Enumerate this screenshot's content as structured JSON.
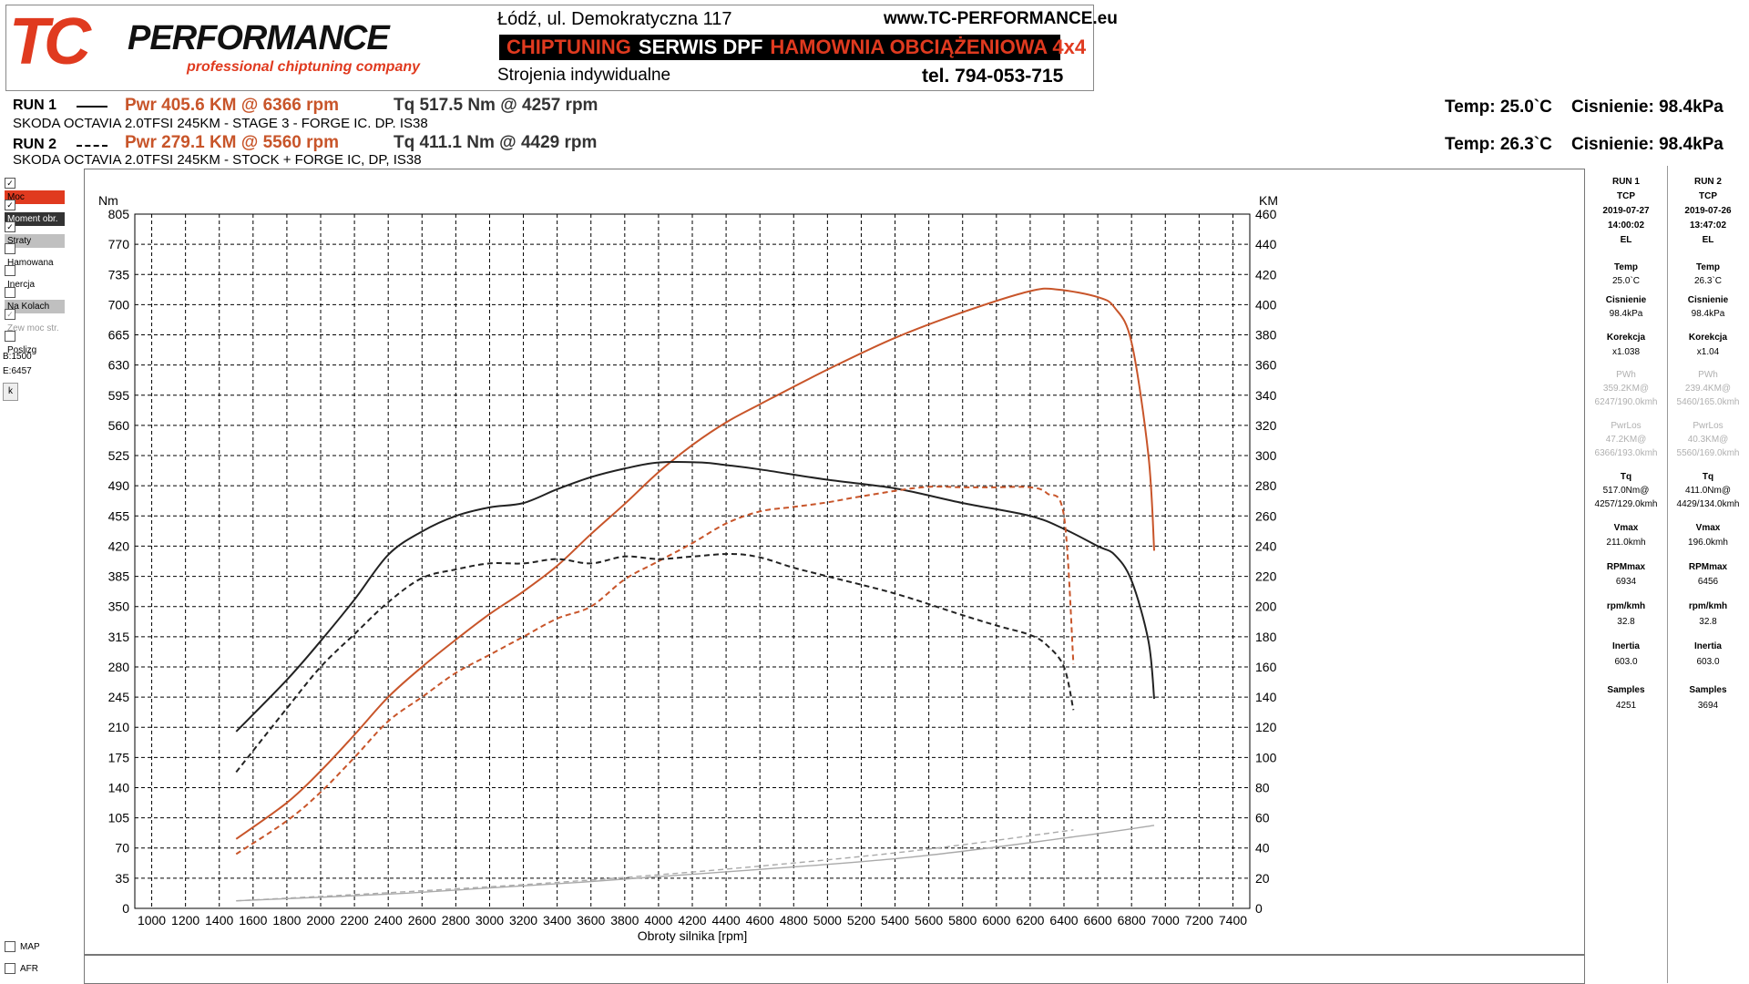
{
  "header": {
    "logo_tc": "TC",
    "logo_perf": "PERFORMANCE",
    "logo_sub": "professional chiptuning company",
    "address": "Łódź, ul. Demokratyczna 117",
    "website": "www.TC-PERFORMANCE.eu",
    "bar_chiptuning": "CHIPTUNING",
    "bar_dpf": "SERWIS DPF",
    "bar_hamownia": "HAMOWNIA OBCIĄŻENIOWA 4x4",
    "individual": "Strojenia indywidualne",
    "phone": "tel. 794-053-715",
    "brand_color": "#e03a1f"
  },
  "runs": [
    {
      "label": "RUN 1",
      "pwr": "Pwr  405.6 KM @ 6366 rpm",
      "tq": "Tq 517.5 Nm @ 4257 rpm",
      "desc": "SKODA OCTAVIA 2.0TFSI 245KM - STAGE 3 - FORGE IC. DP. IS38",
      "temp": "Temp: 25.0`C    Cisnienie: 98.4kPa"
    },
    {
      "label": "RUN 2",
      "pwr": "Pwr  279.1 KM @ 5560 rpm",
      "tq": "Tq 411.1 Nm @ 4429 rpm",
      "desc": "SKODA OCTAVIA 2.0TFSI 245KM - STOCK + FORGE IC, DP, IS38",
      "temp": "Temp: 26.3`C    Cisnienie: 98.4kPa"
    }
  ],
  "left_panel": {
    "checks": [
      {
        "label": "Moc",
        "checked": true,
        "bg": "#e03a1f"
      },
      {
        "label": "Moment obr.",
        "checked": true,
        "bg": "#333333"
      },
      {
        "label": "Straty",
        "checked": true,
        "bg": "#c0c0c0"
      },
      {
        "label": "Hamowana",
        "checked": false,
        "bg": ""
      },
      {
        "label": "Inercja",
        "checked": false,
        "bg": ""
      },
      {
        "label": "Na Kolach",
        "checked": false,
        "bg": "#c0c0c0"
      },
      {
        "label": "Zew moc str.",
        "checked": true,
        "bg": ""
      },
      {
        "label": "Poslizg",
        "checked": false,
        "bg": ""
      }
    ],
    "b_value": "B:1500",
    "e_value": "E:6457",
    "k_button": "k",
    "map": "MAP",
    "afr": "AFR"
  },
  "right_panel": [
    {
      "head": [
        "RUN 1",
        "TCP",
        "2019-07-27",
        "14:00:02",
        "EL"
      ],
      "temp_l": "Temp",
      "temp": "25.0`C",
      "cis_l": "Cisnienie",
      "cis": "98.4kPa",
      "kor_l": "Korekcja",
      "kor": "x1.038",
      "pwh_l": "PWh",
      "pwh": "359.2KM@",
      "pwh2": "6247/190.0kmh",
      "pwrlos_l": "PwrLos",
      "pwrlos": "47.2KM@",
      "pwrlos2": "6366/193.0kmh",
      "tq_l": "Tq",
      "tq": "517.0Nm@",
      "tq2": "4257/129.0kmh",
      "vmax_l": "Vmax",
      "vmax": "211.0kmh",
      "rpmmax_l": "RPMmax",
      "rpmmax": "6934",
      "rpmkmh_l": "rpm/kmh",
      "rpmkmh": "32.8",
      "inertia_l": "Inertia",
      "inertia": "603.0",
      "samples_l": "Samples",
      "samples": "4251"
    },
    {
      "head": [
        "RUN 2",
        "TCP",
        "2019-07-26",
        "13:47:02",
        "EL"
      ],
      "temp_l": "Temp",
      "temp": "26.3`C",
      "cis_l": "Cisnienie",
      "cis": "98.4kPa",
      "kor_l": "Korekcja",
      "kor": "x1.04",
      "pwh_l": "PWh",
      "pwh": "239.4KM@",
      "pwh2": "5460/165.0kmh",
      "pwrlos_l": "PwrLos",
      "pwrlos": "40.3KM@",
      "pwrlos2": "5560/169.0kmh",
      "tq_l": "Tq",
      "tq": "411.0Nm@",
      "tq2": "4429/134.0kmh",
      "vmax_l": "Vmax",
      "vmax": "196.0kmh",
      "rpmmax_l": "RPMmax",
      "rpmmax": "6456",
      "rpmkmh_l": "rpm/kmh",
      "rpmkmh": "32.8",
      "inertia_l": "Inertia",
      "inertia": "603.0",
      "samples_l": "Samples",
      "samples": "3694"
    }
  ],
  "chart_data": {
    "type": "line",
    "xlabel": "Obroty silnika [rpm]",
    "ylabel_left": "Nm",
    "ylabel_right": "KM",
    "xlim": [
      900,
      7500
    ],
    "ylim_left": [
      0,
      805
    ],
    "ylim_right": [
      0,
      460
    ],
    "x_ticks": [
      1000,
      1200,
      1400,
      1600,
      1800,
      2000,
      2200,
      2400,
      2600,
      2800,
      3000,
      3200,
      3400,
      3600,
      3800,
      4000,
      4200,
      4400,
      4600,
      4800,
      5000,
      5200,
      5400,
      5600,
      5800,
      6000,
      6200,
      6400,
      6600,
      6800,
      7000,
      7200,
      7400
    ],
    "y_left_ticks": [
      0,
      35,
      70,
      105,
      140,
      175,
      210,
      245,
      280,
      315,
      350,
      385,
      420,
      455,
      490,
      525,
      560,
      595,
      630,
      665,
      700,
      735,
      770,
      805
    ],
    "y_right_ticks": [
      0,
      20,
      40,
      60,
      80,
      100,
      120,
      140,
      160,
      180,
      200,
      220,
      240,
      260,
      280,
      300,
      320,
      340,
      360,
      380,
      400,
      420,
      440,
      460
    ],
    "grid": true,
    "colors": {
      "power": "#c8552a",
      "torque": "#222222",
      "losses": "#aaaaaa"
    },
    "series": [
      {
        "name": "Moc",
        "run": "RUN 1",
        "axis": "right",
        "color": "#c8552a",
        "dash": false,
        "x": [
          1500,
          1800,
          2000,
          2200,
          2400,
          2600,
          2800,
          3000,
          3200,
          3400,
          3600,
          3800,
          4000,
          4200,
          4400,
          4600,
          5000,
          5400,
          5800,
          6200,
          6366,
          6600,
          6700,
          6800,
          6900,
          6934
        ],
        "y": [
          46,
          70,
          91,
          115,
          140,
          160,
          178,
          195,
          210,
          227,
          248,
          268,
          289,
          307,
          322,
          334,
          357,
          378,
          395,
          409,
          410,
          405,
          398,
          375,
          300,
          237
        ]
      },
      {
        "name": "Moment obr.",
        "run": "RUN 1",
        "axis": "left",
        "color": "#222222",
        "dash": false,
        "x": [
          1500,
          1800,
          2000,
          2200,
          2400,
          2600,
          2800,
          3000,
          3200,
          3400,
          3600,
          3800,
          4000,
          4257,
          4400,
          4600,
          5000,
          5400,
          5800,
          6200,
          6400,
          6600,
          6700,
          6800,
          6900,
          6934
        ],
        "y": [
          205,
          265,
          310,
          358,
          410,
          437,
          455,
          465,
          470,
          486,
          500,
          510,
          517,
          517,
          514,
          509,
          497,
          487,
          470,
          455,
          440,
          420,
          410,
          380,
          310,
          243
        ]
      },
      {
        "name": "Moc",
        "run": "RUN 2",
        "axis": "right",
        "color": "#c8552a",
        "dash": true,
        "x": [
          1500,
          1800,
          2000,
          2200,
          2400,
          2600,
          2800,
          3000,
          3200,
          3400,
          3600,
          3800,
          4000,
          4200,
          4400,
          4600,
          4800,
          5000,
          5200,
          5560,
          5800,
          6000,
          6200,
          6300,
          6400,
          6456
        ],
        "y": [
          36,
          58,
          77,
          100,
          124,
          140,
          156,
          168,
          180,
          192,
          200,
          218,
          230,
          242,
          255,
          263,
          266,
          269,
          273,
          279,
          279,
          279,
          279,
          275,
          260,
          162
        ]
      },
      {
        "name": "Moment obr.",
        "run": "RUN 2",
        "axis": "left",
        "color": "#222222",
        "dash": true,
        "x": [
          1500,
          1800,
          2000,
          2200,
          2400,
          2600,
          2800,
          3000,
          3200,
          3400,
          3600,
          3800,
          4000,
          4200,
          4429,
          4600,
          4800,
          5000,
          5400,
          5800,
          6000,
          6200,
          6300,
          6400,
          6456
        ],
        "y": [
          158,
          232,
          280,
          318,
          355,
          383,
          393,
          400,
          400,
          405,
          400,
          408,
          405,
          408,
          411,
          407,
          395,
          385,
          365,
          340,
          328,
          317,
          305,
          280,
          230
        ]
      },
      {
        "name": "Straty",
        "run": "RUN 1",
        "axis": "right",
        "color": "#aaaaaa",
        "dash": false,
        "x": [
          1500,
          2500,
          3500,
          4500,
          5500,
          6500,
          6934
        ],
        "y": [
          5,
          10,
          17,
          25,
          34,
          48,
          55
        ]
      },
      {
        "name": "Straty",
        "run": "RUN 2",
        "axis": "right",
        "color": "#aaaaaa",
        "dash": true,
        "x": [
          1500,
          2500,
          3500,
          4500,
          5500,
          6456
        ],
        "y": [
          5,
          11,
          18,
          27,
          38,
          52
        ]
      }
    ]
  }
}
